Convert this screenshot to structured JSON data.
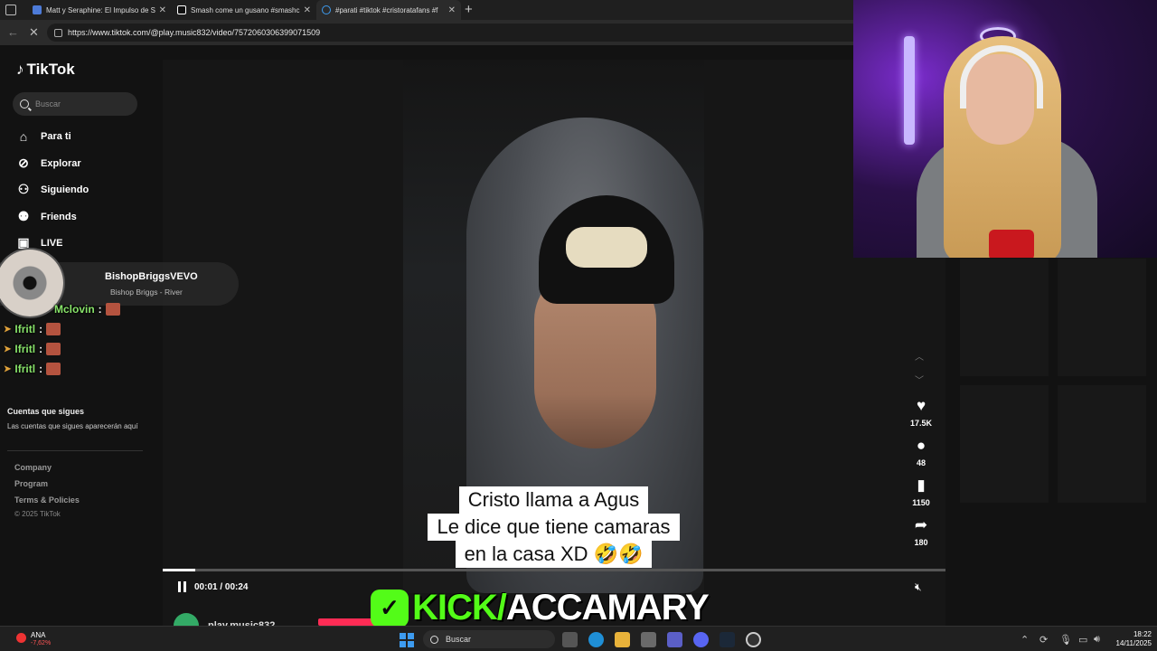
{
  "browser": {
    "tabs": [
      {
        "title": "Matt y Seraphine: El Impulso de S"
      },
      {
        "title": "Smash come un gusano #smashc"
      },
      {
        "title": "#parati #tiktok #cristoratafans #f"
      }
    ],
    "url": "https://www.tiktok.com/@play.music832/video/7572060306399071509"
  },
  "tiktok": {
    "logo": "TikTok",
    "search_placeholder": "Buscar",
    "nav": [
      "Para ti",
      "Explorar",
      "Siguiendo",
      "Friends",
      "LIVE"
    ],
    "followed_heading": "Cuentas que sigues",
    "followed_empty": "Las cuentas que sigues aparecerán aquí",
    "footer": [
      "Company",
      "Program",
      "Terms & Policies"
    ],
    "copyright": "© 2025 TikTok"
  },
  "video": {
    "caption_lines": [
      "Cristo llama a Agus",
      "Le dice que tiene camaras",
      "en la casa XD 🤣🤣"
    ],
    "time": "00:01 / 00:24",
    "progress": 0.0417,
    "likes": "17.5K",
    "comments": "48",
    "saves": "1150",
    "shares": "180",
    "author": "play.music832"
  },
  "now_playing": {
    "artist": "BishopBriggsVEVO",
    "track": "Bishop Briggs - River"
  },
  "chat": [
    {
      "user": "Mclovin"
    },
    {
      "user": "Ifritl"
    },
    {
      "user": "Ifritl"
    },
    {
      "user": "Ifritl"
    }
  ],
  "branding": {
    "kick": "KICK/",
    "channel": "ACCAMARY",
    "accent": "#53fc18"
  },
  "taskbar": {
    "stock_name": "ANA",
    "stock_change": "-7,62%",
    "search_placeholder": "Buscar",
    "time": "18:22",
    "date": "14/11/2025"
  }
}
